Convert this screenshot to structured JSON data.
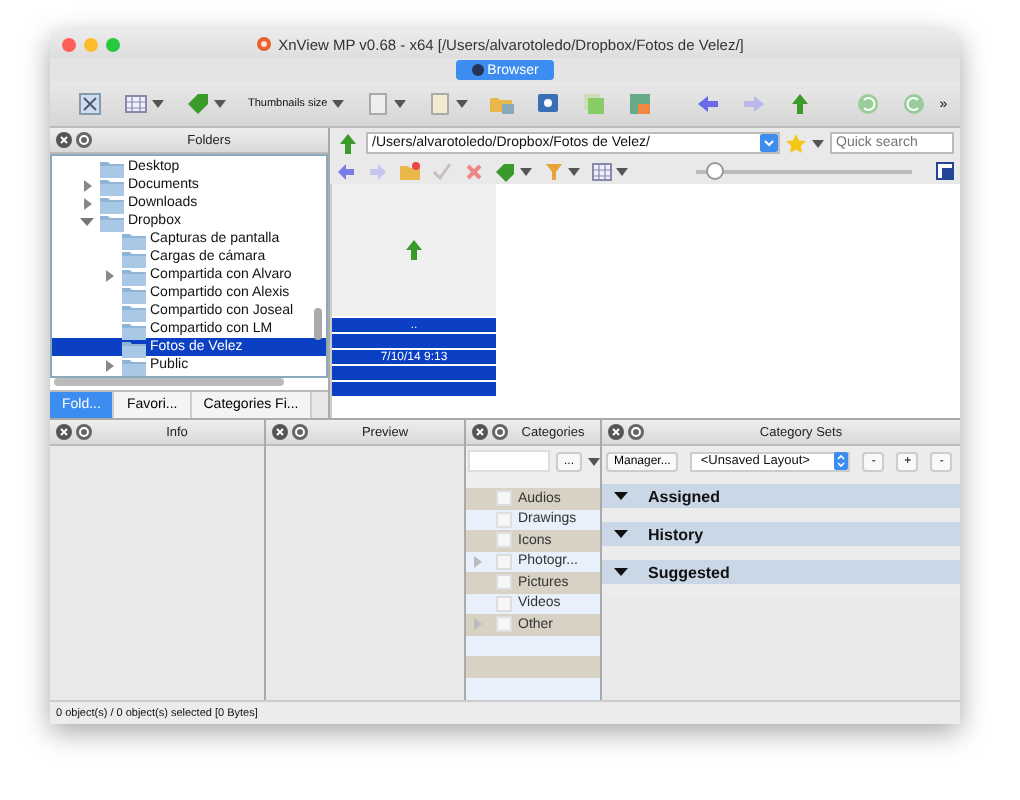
{
  "window": {
    "title": "XnView MP v0.68 - x64 [/Users/alvarotoledo/Dropbox/Fotos de Velez/]"
  },
  "mode_tab": {
    "label": "Browser",
    "selected": true
  },
  "toolbar": {
    "thumbnails_size": "Thumbnails size",
    "overflow": "»"
  },
  "folders": {
    "title": "Folders",
    "tree": [
      {
        "label": "Desktop",
        "kind": "leaf",
        "selected": false
      },
      {
        "label": "Documents",
        "kind": "branch",
        "expanded": false,
        "selected": false
      },
      {
        "label": "Downloads",
        "kind": "branch",
        "expanded": false,
        "selected": false
      },
      {
        "label": "Dropbox",
        "kind": "branch",
        "expanded": true,
        "selected": false,
        "children": [
          {
            "label": "Capturas de pantalla",
            "kind": "leaf",
            "selected": false
          },
          {
            "label": "Cargas de cámara",
            "kind": "leaf",
            "selected": false
          },
          {
            "label": "Compartida con Alvaro",
            "kind": "branch",
            "expanded": false,
            "selected": false
          },
          {
            "label": "Compartido con Alexis",
            "kind": "leaf",
            "selected": false
          },
          {
            "label": "Compartido con Joseal",
            "kind": "leaf",
            "selected": false
          },
          {
            "label": "Compartido con LM",
            "kind": "leaf",
            "selected": false
          },
          {
            "label": "Fotos de Velez",
            "kind": "leaf",
            "selected": true
          },
          {
            "label": "Public",
            "kind": "branch",
            "expanded": false,
            "selected": false
          }
        ]
      }
    ],
    "tabs": [
      {
        "label": "Fold...",
        "selected": true
      },
      {
        "label": "Favori...",
        "selected": false
      },
      {
        "label": "Categories Fi...",
        "selected": false
      }
    ]
  },
  "browser": {
    "path": "/Users/alvarotoledo/Dropbox/Fotos de Velez/",
    "search": {
      "placeholder": "Quick search"
    },
    "zoom": {
      "level": 0.08
    },
    "thumbnails": [
      {
        "name": "..",
        "date": "7/10/14 9:13",
        "selected": true
      }
    ]
  },
  "info": {
    "title": "Info"
  },
  "preview": {
    "title": "Preview"
  },
  "categories": {
    "title": "Categories",
    "more_button": "...",
    "items": [
      {
        "label": "Audios",
        "checked": false,
        "kind": "leaf"
      },
      {
        "label": "Drawings",
        "checked": false,
        "kind": "leaf"
      },
      {
        "label": "Icons",
        "checked": false,
        "kind": "leaf"
      },
      {
        "label": "Photogr...",
        "checked": false,
        "kind": "branch"
      },
      {
        "label": "Pictures",
        "checked": false,
        "kind": "leaf"
      },
      {
        "label": "Videos",
        "checked": false,
        "kind": "leaf"
      },
      {
        "label": "Other",
        "checked": false,
        "kind": "branch"
      }
    ]
  },
  "category_sets": {
    "title": "Category Sets",
    "manager_button": "Manager...",
    "layout": "<Unsaved Layout>",
    "buttons": [
      "-",
      "+",
      "-"
    ],
    "sections": [
      {
        "label": "Assigned",
        "expanded": true
      },
      {
        "label": "History",
        "expanded": true
      },
      {
        "label": "Suggested",
        "expanded": true
      }
    ]
  },
  "status_bar": "0 object(s) / 0 object(s) selected [0 Bytes]"
}
